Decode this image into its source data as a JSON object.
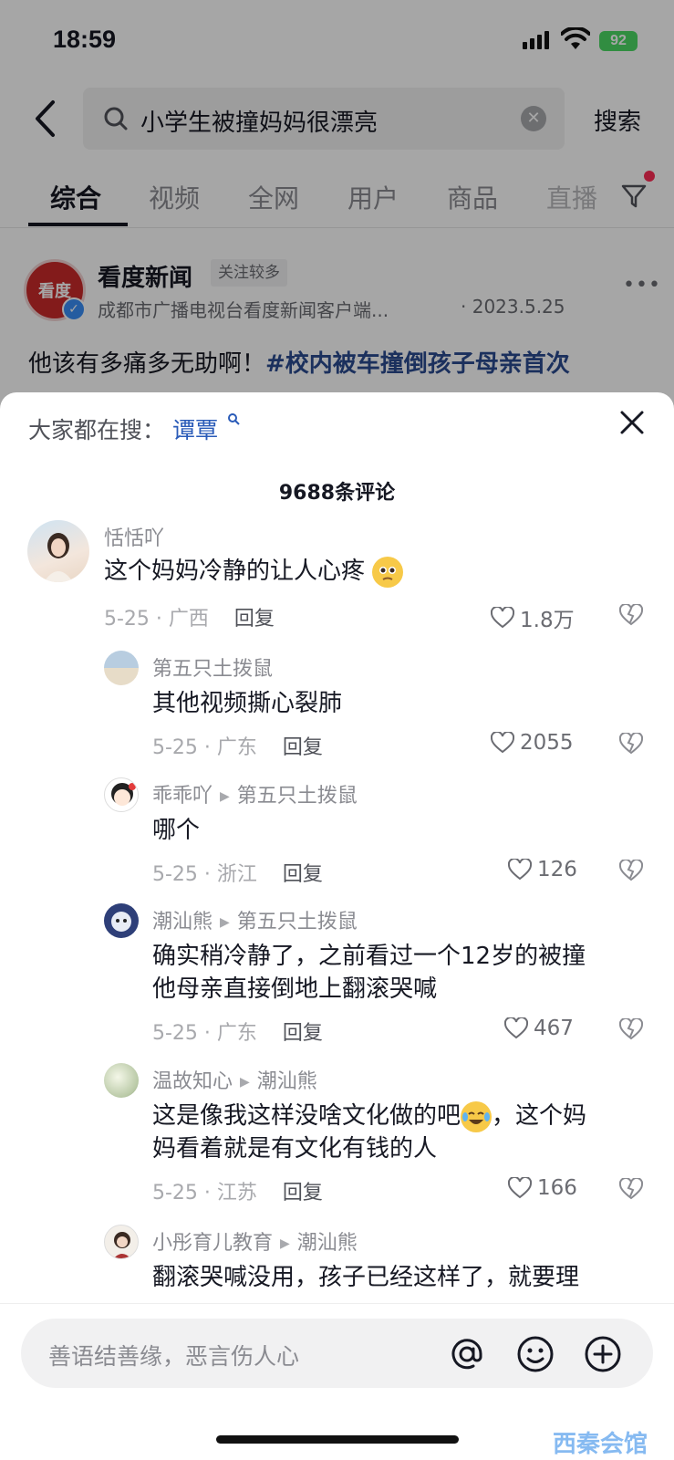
{
  "status_bar": {
    "time": "18:59",
    "battery": "92"
  },
  "search": {
    "query": "小学生被撞妈妈很漂亮",
    "button_label": "搜索"
  },
  "tabs": [
    "综合",
    "视频",
    "全网",
    "用户",
    "商品",
    "直播"
  ],
  "post": {
    "avatar_text": "看度",
    "author": "看度新闻",
    "badge": "关注较多",
    "subtitle": "成都市广播电视台看度新闻客户端...",
    "date": "· 2023.5.25",
    "text_plain": "他该有多痛多无助啊！",
    "text_tag": "#校内被车撞倒孩子母亲首次"
  },
  "sheet": {
    "hot_label": "大家都在搜：",
    "hot_keyword": "谭覃",
    "comment_count": "9688条评论"
  },
  "comments": [
    {
      "user": "恬恬吖",
      "reply_to": "",
      "text": "这个妈妈冷静的让人心疼",
      "date_loc": "5-25 · 广西",
      "reply_label": "回复",
      "likes": "1.8万",
      "level": 0
    },
    {
      "user": "第五只土拨鼠",
      "reply_to": "",
      "text": "其他视频撕心裂肺",
      "date_loc": "5-25 · 广东",
      "reply_label": "回复",
      "likes": "2055",
      "level": 1
    },
    {
      "user": "乖乖吖",
      "reply_to": "第五只土拨鼠",
      "text": "哪个",
      "date_loc": "5-25 · 浙江",
      "reply_label": "回复",
      "likes": "126",
      "level": 1
    },
    {
      "user": "潮汕熊",
      "reply_to": "第五只土拨鼠",
      "text": "确实稍冷静了，之前看过一个12岁的被撞",
      "text2": "他母亲直接倒地上翻滚哭喊",
      "date_loc": "5-25 · 广东",
      "reply_label": "回复",
      "likes": "467",
      "level": 1
    },
    {
      "user": "温故知心",
      "reply_to": "潮汕熊",
      "text": "这是像我这样没啥文化做的吧",
      "text_b": "，这个妈",
      "text2": "妈看着就是有文化有钱的人",
      "date_loc": "5-25 · 江苏",
      "reply_label": "回复",
      "likes": "166",
      "level": 1
    },
    {
      "user": "小彤育儿教育",
      "reply_to": "潮汕熊",
      "text": "翻滚哭喊没用，孩子已经这样了，就要理",
      "level": 1
    }
  ],
  "input": {
    "placeholder": "善语结善缘，恶言伤人心"
  },
  "watermark": "西秦会馆"
}
